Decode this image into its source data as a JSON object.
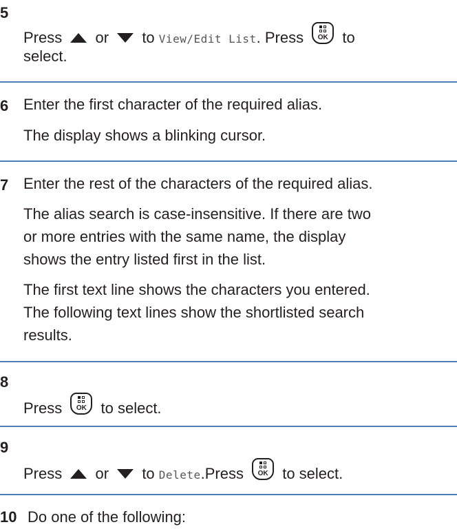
{
  "steps": [
    {
      "number": "5",
      "parts": {
        "press": "Press",
        "or": "or",
        "to": "to",
        "menu": "View/Edit List",
        "press2": ". Press",
        "to_select": "to",
        "select_word": "select."
      }
    },
    {
      "number": "6",
      "text": "Enter the first character of the required alias.",
      "result": "The display shows a blinking cursor."
    },
    {
      "number": "7",
      "text": "Enter the rest of the characters of the required alias.",
      "result1_line1": "The alias search is case-insensitive. If there are two",
      "result1_line2": "or more entries with the same name, the display",
      "result1_line3": "shows the entry listed first in the list.",
      "result2_line1": "The first text line shows the characters you entered.",
      "result2_line2": "The following text lines show the shortlisted search",
      "result2_line3": "results."
    },
    {
      "number": "8",
      "parts": {
        "press": "Press",
        "to_select": "to select."
      }
    },
    {
      "number": "9",
      "parts": {
        "press": "Press",
        "or": "or",
        "to": "to",
        "menu": "Delete",
        "press2": ".Press",
        "to_select": "to select."
      }
    },
    {
      "number": "10",
      "text": "Do one of the following:"
    }
  ],
  "ok_button": {
    "label": "OK"
  },
  "icons": {
    "up": "up-arrow-icon",
    "down": "down-arrow-icon",
    "ok": "ok-menu-button-icon"
  },
  "colors": {
    "rule": "#4a7fb5",
    "text": "#231f20"
  }
}
